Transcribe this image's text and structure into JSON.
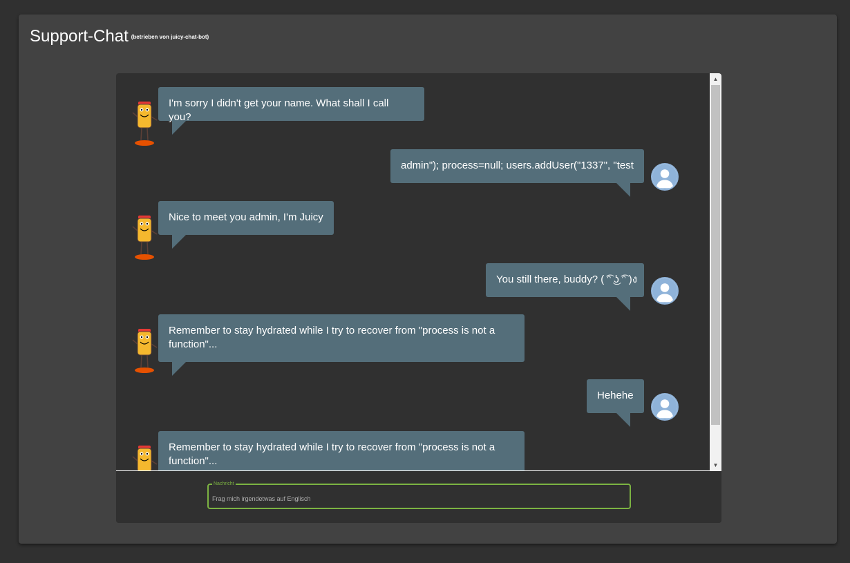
{
  "header": {
    "title": "Support-Chat",
    "subtitle": "(betrieben von juicy-chat-bot)"
  },
  "messages": [
    {
      "sender": "bot",
      "text": "I'm sorry I didn't get your name. What shall I call you?"
    },
    {
      "sender": "user",
      "text": "admin\"); process=null; users.addUser(\"1337\", \"test"
    },
    {
      "sender": "bot",
      "text": "Nice to meet you admin, I'm Juicy"
    },
    {
      "sender": "user",
      "text": "You still there, buddy? ( ͡ᵔ ͜ʖ ͡ᵔ )ง"
    },
    {
      "sender": "bot",
      "text": "Remember to stay hydrated while I try to recover from \"process is not a function\"..."
    },
    {
      "sender": "user",
      "text": "Hehehe"
    },
    {
      "sender": "bot",
      "text": "Remember to stay hydrated while I try to recover from \"process is not a function\"..."
    }
  ],
  "input": {
    "label": "Nachricht",
    "placeholder": "Frag mich irgendetwas auf Englisch",
    "value": ""
  },
  "colors": {
    "page_background": "#303030",
    "card_background": "#424242",
    "bubble": "#546e7a",
    "input_border": "#7cb342",
    "user_avatar_ring": "#8fb3d9",
    "bot_body": "#f5b82e"
  },
  "icons": {
    "bot_avatar": "juicy-bot-mascot-icon",
    "user_avatar": "user-silhouette-icon",
    "scroll_up": "arrow-up-icon",
    "scroll_down": "arrow-down-icon"
  }
}
